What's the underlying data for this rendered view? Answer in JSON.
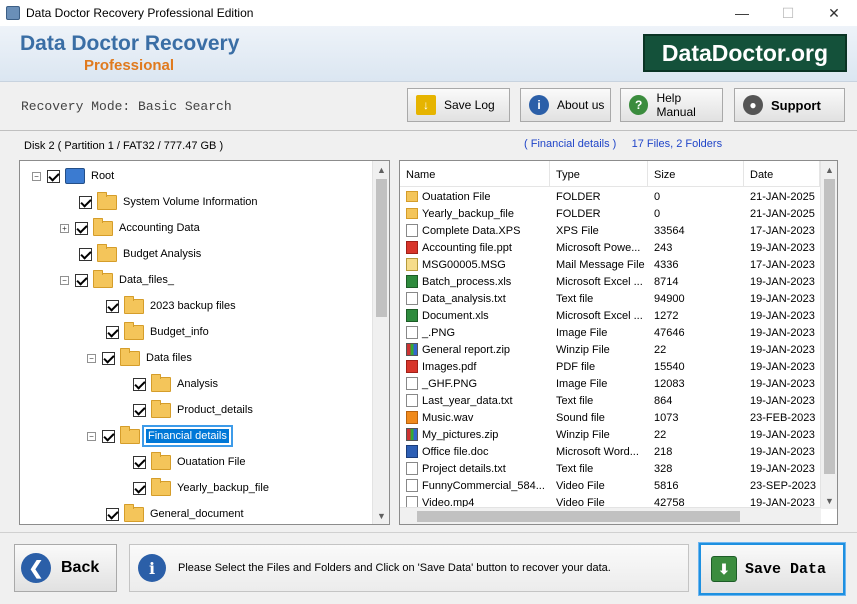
{
  "window": {
    "title": "Data Doctor Recovery Professional Edition"
  },
  "banner": {
    "title": "Data Doctor Recovery",
    "subtitle": "Professional",
    "logo": "DataDoctor.org"
  },
  "toolbar": {
    "mode": "Recovery Mode: Basic Search",
    "save_log": "Save Log",
    "about": "About us",
    "help": "Help Manual",
    "support": "Support"
  },
  "disk_info": "Disk 2 ( Partition 1 / FAT32 / 777.47 GB )",
  "folder_info": "( Financial details )     17 Files, 2 Folders",
  "tree": [
    {
      "label": "Root"
    },
    {
      "label": "System Volume Information"
    },
    {
      "label": "Accounting Data"
    },
    {
      "label": "Budget Analysis"
    },
    {
      "label": "Data_files_"
    },
    {
      "label": "2023 backup files"
    },
    {
      "label": "Budget_info"
    },
    {
      "label": "Data files"
    },
    {
      "label": "Analysis"
    },
    {
      "label": "Product_details"
    },
    {
      "label": "Financial details"
    },
    {
      "label": "Ouatation File"
    },
    {
      "label": "Yearly_backup_file"
    },
    {
      "label": "General_document"
    }
  ],
  "columns": [
    "Name",
    "Type",
    "Size",
    "Date"
  ],
  "files": [
    {
      "name": "Ouatation File",
      "type": "FOLDER",
      "size": "0",
      "date": "21-JAN-2025",
      "icon": "folder"
    },
    {
      "name": "Yearly_backup_file",
      "type": "FOLDER",
      "size": "0",
      "date": "21-JAN-2025",
      "icon": "folder"
    },
    {
      "name": "Complete Data.XPS",
      "type": "XPS File",
      "size": "33564",
      "date": "17-JAN-2023",
      "icon": "doc"
    },
    {
      "name": "Accounting file.ppt",
      "type": "Microsoft Powe...",
      "size": "243",
      "date": "19-JAN-2023",
      "icon": "red"
    },
    {
      "name": "MSG00005.MSG",
      "type": "Mail Message File",
      "size": "4336",
      "date": "17-JAN-2023",
      "icon": "mail"
    },
    {
      "name": "Batch_process.xls",
      "type": "Microsoft Excel ...",
      "size": "8714",
      "date": "19-JAN-2023",
      "icon": "green"
    },
    {
      "name": "Data_analysis.txt",
      "type": "Text file",
      "size": "94900",
      "date": "19-JAN-2023",
      "icon": "doc"
    },
    {
      "name": "Document.xls",
      "type": "Microsoft Excel ...",
      "size": "1272",
      "date": "19-JAN-2023",
      "icon": "green"
    },
    {
      "name": "_.PNG",
      "type": "Image File",
      "size": "47646",
      "date": "19-JAN-2023",
      "icon": "doc"
    },
    {
      "name": "General report.zip",
      "type": "Winzip File",
      "size": "22",
      "date": "19-JAN-2023",
      "icon": "zip"
    },
    {
      "name": "Images.pdf",
      "type": "PDF file",
      "size": "15540",
      "date": "19-JAN-2023",
      "icon": "red"
    },
    {
      "name": "_GHF.PNG",
      "type": "Image File",
      "size": "12083",
      "date": "19-JAN-2023",
      "icon": "doc"
    },
    {
      "name": "Last_year_data.txt",
      "type": "Text file",
      "size": "864",
      "date": "19-JAN-2023",
      "icon": "doc"
    },
    {
      "name": "Music.wav",
      "type": "Sound file",
      "size": "1073",
      "date": "23-FEB-2023",
      "icon": "orange"
    },
    {
      "name": "My_pictures.zip",
      "type": "Winzip File",
      "size": "22",
      "date": "19-JAN-2023",
      "icon": "zip"
    },
    {
      "name": "Office file.doc",
      "type": "Microsoft Word...",
      "size": "218",
      "date": "19-JAN-2023",
      "icon": "blue"
    },
    {
      "name": "Project details.txt",
      "type": "Text file",
      "size": "328",
      "date": "19-JAN-2023",
      "icon": "doc"
    },
    {
      "name": "FunnyCommercial_584...",
      "type": "Video File",
      "size": "5816",
      "date": "23-SEP-2023",
      "icon": "doc"
    },
    {
      "name": "Video.mp4",
      "type": "Video File",
      "size": "42758",
      "date": "19-JAN-2023",
      "icon": "doc"
    }
  ],
  "bottom": {
    "back": "Back",
    "message": "Please Select the Files and Folders and Click on 'Save Data' button to recover your data.",
    "save": "Save Data"
  }
}
